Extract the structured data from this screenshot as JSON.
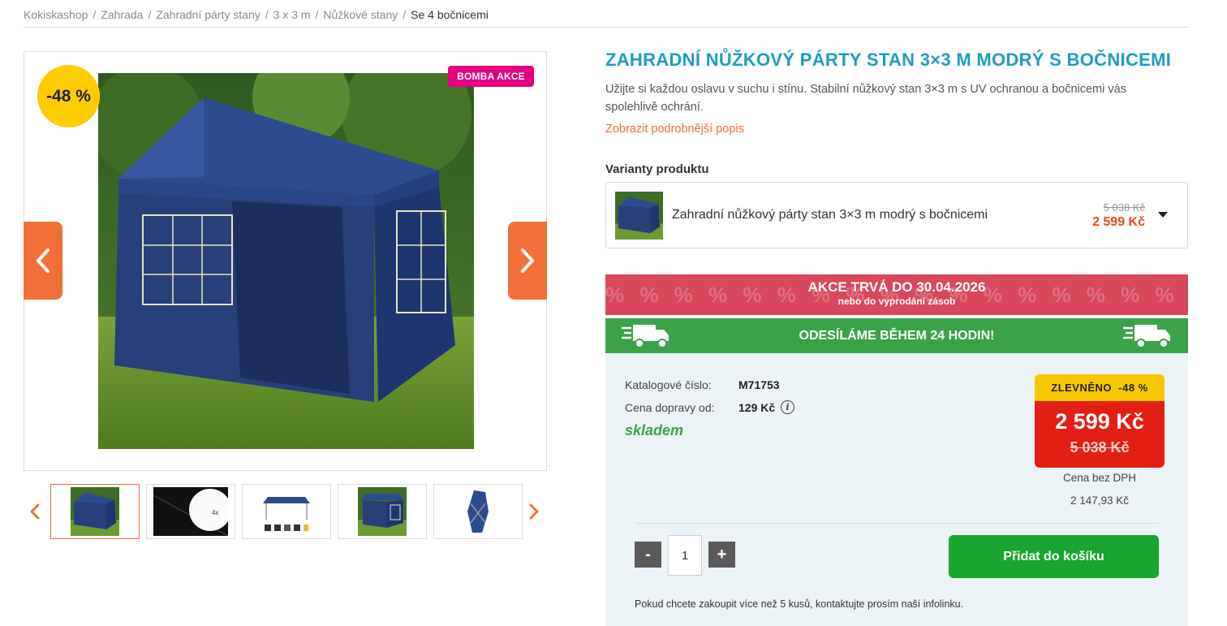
{
  "breadcrumb": {
    "items": [
      "Kokiskashop",
      "Zahrada",
      "Zahradní párty stany",
      "3 x 3 m",
      "Nůžkové stany",
      "Se 4 bočnicemi"
    ],
    "separator": "/"
  },
  "gallery": {
    "discount_label": "-48 %",
    "promo_badge": "BOMBA AKCE",
    "prev_icon": "chevron-left-icon",
    "next_icon": "chevron-right-icon",
    "thumbnail_count": 5,
    "active_thumbnail": 1
  },
  "product": {
    "title": "ZAHRADNÍ NŮŽKOVÝ PÁRTY STAN 3×3 M MODRÝ S BOČNICEMI",
    "description": "Užijte si každou oslavu v suchu i stínu. Stabilní nůžkový stan 3×3 m s UV ochranou a bočnicemi vás spolehlivě ochrání.",
    "more_link": "Zobrazit podrobnější popis"
  },
  "variants": {
    "label": "Varianty produktu",
    "selected_name": "Zahradní nůžkový párty stan 3×3 m modrý s bočnicemi",
    "old_price": "5 038 Kč",
    "new_price": "2 599 Kč"
  },
  "banners": {
    "akce_main": "AKCE TRVÁ DO 30.04.2026",
    "akce_sub": "nebo do vyprodání zásob",
    "shipping": "ODESÍLÁME BĚHEM 24 HODIN!"
  },
  "details": {
    "catalog_label": "Katalogové číslo:",
    "catalog_value": "M71753",
    "shipping_label": "Cena dopravy od:",
    "shipping_value": "129 Kč",
    "stock": "skladem"
  },
  "price": {
    "discount_label": "ZLEVNĚNO",
    "discount_value": "-48 %",
    "new": "2 599 Kč",
    "old": "5 038 Kč",
    "no_vat_label": "Cena bez DPH",
    "no_vat_value": "2 147,93 Kč"
  },
  "cart": {
    "minus": "-",
    "plus": "+",
    "quantity": "1",
    "add_button": "Přidat do košíku",
    "note": "Pokud chcete zakoupit více než 5 kusů, kontaktujte prosím naší infolinku."
  },
  "colors": {
    "accent_orange": "#f26f3a",
    "title_blue": "#1f9bc4",
    "promo_pink": "#e6007e",
    "akce_red": "#d9475c",
    "ship_green": "#3ba24a",
    "price_red": "#e31e13",
    "discount_yellow": "#f7c700",
    "cart_green": "#1aa531"
  }
}
